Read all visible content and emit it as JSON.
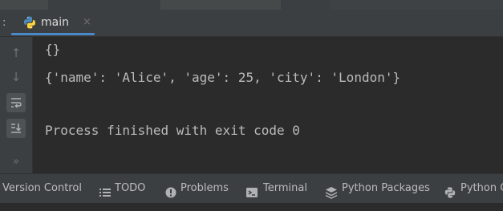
{
  "colors": {
    "background": "#2b2b2b",
    "panel": "#3c3f41",
    "text": "#bbbbbb",
    "accent": "#4a88c7",
    "python_blue": "#4b8bbe",
    "python_yellow": "#ffd43b"
  },
  "tab": {
    "prefix": ":",
    "label": "main",
    "close": "×",
    "icon": "python-icon",
    "active": true
  },
  "toolbar": {
    "buttons": [
      {
        "name": "rerun-up-icon",
        "glyph": "↑"
      },
      {
        "name": "arrow-down-icon",
        "glyph": "↓"
      },
      {
        "name": "soft-wrap-icon",
        "active": true
      },
      {
        "name": "scroll-to-end-icon",
        "active": true
      },
      {
        "name": "more-icon",
        "glyph": "»"
      }
    ]
  },
  "console": {
    "lines": [
      "{}",
      "{'name': 'Alice', 'age': 25, 'city': 'London'}",
      "",
      "Process finished with exit code 0"
    ]
  },
  "statusbar": {
    "items": [
      {
        "label": "Version Control",
        "icon": null
      },
      {
        "label": "TODO",
        "icon": "list-icon"
      },
      {
        "label": "Problems",
        "icon": "warning-icon"
      },
      {
        "label": "Terminal",
        "icon": "terminal-icon"
      },
      {
        "label": "Python Packages",
        "icon": "layers-icon"
      },
      {
        "label": "Python Co",
        "icon": "python-icon"
      }
    ]
  }
}
